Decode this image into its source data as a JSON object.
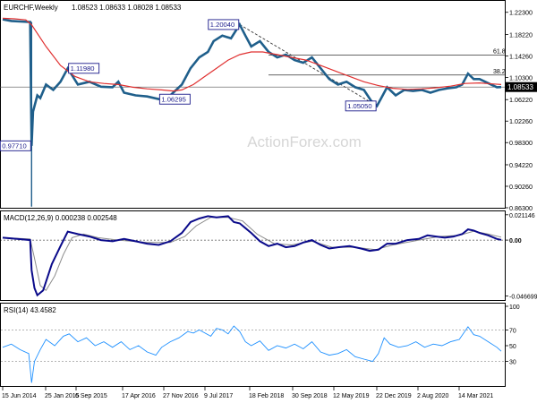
{
  "chart_data": [
    {
      "type": "candlestick",
      "header": {
        "symbol": "EURCHF,Weekly",
        "ohlc": "1.08523 1.08633 1.08028 1.08533"
      },
      "watermark": "ActionForex.com",
      "ylim": [
        0.863,
        1.244
      ],
      "y_ticks": [
        "1.22300",
        "1.18220",
        "1.14260",
        "1.10300",
        "1.06220",
        "1.02260",
        "0.98300",
        "0.94220",
        "0.90260",
        "0.86300"
      ],
      "x_ticks": [
        "15 Jun 2014",
        "25 Jan 2015",
        "6 Sep 2015",
        "17 Apr 2016",
        "27 Nov 2016",
        "9 Jul 2017",
        "18 Feb 2018",
        "30 Sep 2018",
        "12 May 2019",
        "22 Dec 2019",
        "2 Aug 2020",
        "14 Mar 2021"
      ],
      "current_price": "1.08533",
      "ma_color": "#e03030",
      "price_color": "#1f5f8b",
      "price_path": [
        [
          0,
          1.21
        ],
        [
          6,
          1.207
        ],
        [
          12,
          1.206
        ],
        [
          19,
          1.205
        ],
        [
          20,
          0.9771
        ],
        [
          21,
          1.04
        ],
        [
          24,
          1.07
        ],
        [
          26,
          1.065
        ],
        [
          30,
          1.09
        ],
        [
          35,
          1.08
        ],
        [
          40,
          1.095
        ],
        [
          45,
          1.1198
        ],
        [
          52,
          1.09
        ],
        [
          60,
          1.095
        ],
        [
          68,
          1.086
        ],
        [
          76,
          1.085
        ],
        [
          80,
          1.095
        ],
        [
          84,
          1.075
        ],
        [
          92,
          1.07
        ],
        [
          100,
          1.068
        ],
        [
          108,
          1.063
        ],
        [
          116,
          1.07
        ],
        [
          124,
          1.09
        ],
        [
          130,
          1.12
        ],
        [
          136,
          1.14
        ],
        [
          142,
          1.15
        ],
        [
          146,
          1.17
        ],
        [
          152,
          1.18
        ],
        [
          158,
          1.175
        ],
        [
          164,
          1.2004
        ],
        [
          168,
          1.18
        ],
        [
          172,
          1.16
        ],
        [
          178,
          1.17
        ],
        [
          184,
          1.15
        ],
        [
          190,
          1.14
        ],
        [
          196,
          1.145
        ],
        [
          202,
          1.135
        ],
        [
          208,
          1.13
        ],
        [
          214,
          1.14
        ],
        [
          220,
          1.12
        ],
        [
          226,
          1.1
        ],
        [
          232,
          1.09
        ],
        [
          238,
          1.095
        ],
        [
          244,
          1.085
        ],
        [
          250,
          1.08
        ],
        [
          255,
          1.06
        ],
        [
          259,
          1.0505
        ],
        [
          262,
          1.065
        ],
        [
          266,
          1.085
        ],
        [
          272,
          1.07
        ],
        [
          278,
          1.08
        ],
        [
          284,
          1.078
        ],
        [
          290,
          1.08
        ],
        [
          296,
          1.075
        ],
        [
          302,
          1.08
        ],
        [
          308,
          1.083
        ],
        [
          314,
          1.085
        ],
        [
          318,
          1.09
        ],
        [
          322,
          1.11
        ],
        [
          326,
          1.1
        ],
        [
          330,
          1.1
        ],
        [
          334,
          1.095
        ],
        [
          338,
          1.09
        ],
        [
          342,
          1.085
        ],
        [
          345,
          1.0853
        ]
      ],
      "ma_path": [
        [
          0,
          1.212
        ],
        [
          8,
          1.211
        ],
        [
          16,
          1.209
        ],
        [
          20,
          1.2
        ],
        [
          30,
          1.16
        ],
        [
          40,
          1.125
        ],
        [
          50,
          1.105
        ],
        [
          60,
          1.095
        ],
        [
          70,
          1.092
        ],
        [
          80,
          1.09
        ],
        [
          90,
          1.085
        ],
        [
          100,
          1.082
        ],
        [
          110,
          1.08
        ],
        [
          118,
          1.078
        ],
        [
          124,
          1.08
        ],
        [
          132,
          1.09
        ],
        [
          140,
          1.105
        ],
        [
          148,
          1.12
        ],
        [
          156,
          1.135
        ],
        [
          164,
          1.145
        ],
        [
          172,
          1.15
        ],
        [
          180,
          1.15
        ],
        [
          190,
          1.145
        ],
        [
          200,
          1.14
        ],
        [
          210,
          1.135
        ],
        [
          220,
          1.125
        ],
        [
          230,
          1.115
        ],
        [
          240,
          1.105
        ],
        [
          250,
          1.095
        ],
        [
          260,
          1.088
        ],
        [
          270,
          1.083
        ],
        [
          280,
          1.081
        ],
        [
          290,
          1.082
        ],
        [
          300,
          1.084
        ],
        [
          310,
          1.087
        ],
        [
          320,
          1.092
        ],
        [
          330,
          1.093
        ],
        [
          340,
          1.091
        ],
        [
          345,
          1.09
        ]
      ],
      "annotations": [
        {
          "label": "1.20040",
          "t": 164,
          "price": 1.2004,
          "side": "left"
        },
        {
          "label": "1.11980",
          "t": 45,
          "price": 1.1198,
          "side": "right"
        },
        {
          "label": "1.06295",
          "t": 108,
          "price": 1.063,
          "side": "right"
        },
        {
          "label": "0.97710",
          "t": 20,
          "price": 0.9771,
          "side": "left"
        },
        {
          "label": "1.05050",
          "t": 259,
          "price": 1.0505,
          "side": "left"
        }
      ],
      "trendline": [
        [
          164,
          1.2004
        ],
        [
          259,
          1.0505
        ]
      ],
      "fib": [
        {
          "label": "61.8",
          "price": 1.144
        },
        {
          "label": "38.2",
          "price": 1.1075
        }
      ]
    },
    {
      "type": "line",
      "title": "MACD(12,26,9) 0.000238 0.002548",
      "ylim": [
        -0.05,
        0.024
      ],
      "y_ticks": [
        "0.021146",
        "0.00",
        "-0.046699"
      ],
      "macd_color": "#0a0a8a",
      "signal_color": "#8a8a8a",
      "macd_path": [
        [
          0,
          0.002
        ],
        [
          10,
          0.001
        ],
        [
          19,
          0.0
        ],
        [
          20,
          -0.025
        ],
        [
          22,
          -0.04
        ],
        [
          24,
          -0.046
        ],
        [
          28,
          -0.042
        ],
        [
          34,
          -0.02
        ],
        [
          40,
          -0.005
        ],
        [
          45,
          0.007
        ],
        [
          52,
          0.005
        ],
        [
          60,
          0.003
        ],
        [
          68,
          0.0
        ],
        [
          76,
          -0.001
        ],
        [
          84,
          0.001
        ],
        [
          92,
          -0.001
        ],
        [
          100,
          -0.003
        ],
        [
          108,
          -0.004
        ],
        [
          116,
          -0.001
        ],
        [
          124,
          0.006
        ],
        [
          130,
          0.015
        ],
        [
          136,
          0.018
        ],
        [
          142,
          0.02
        ],
        [
          148,
          0.019
        ],
        [
          156,
          0.02
        ],
        [
          160,
          0.015
        ],
        [
          164,
          0.014
        ],
        [
          168,
          0.01
        ],
        [
          172,
          0.006
        ],
        [
          178,
          -0.001
        ],
        [
          184,
          -0.005
        ],
        [
          190,
          -0.003
        ],
        [
          196,
          -0.006
        ],
        [
          202,
          -0.005
        ],
        [
          208,
          -0.002
        ],
        [
          214,
          0.0
        ],
        [
          220,
          -0.004
        ],
        [
          226,
          -0.007
        ],
        [
          232,
          -0.006
        ],
        [
          240,
          -0.005
        ],
        [
          248,
          -0.007
        ],
        [
          254,
          -0.009
        ],
        [
          260,
          -0.008
        ],
        [
          266,
          -0.003
        ],
        [
          272,
          -0.003
        ],
        [
          280,
          0.0
        ],
        [
          288,
          0.001
        ],
        [
          294,
          0.004
        ],
        [
          300,
          0.003
        ],
        [
          306,
          0.002
        ],
        [
          312,
          0.003
        ],
        [
          318,
          0.005
        ],
        [
          322,
          0.009
        ],
        [
          326,
          0.008
        ],
        [
          330,
          0.006
        ],
        [
          336,
          0.004
        ],
        [
          342,
          0.001
        ],
        [
          345,
          0.0002
        ]
      ],
      "signal_path": [
        [
          0,
          0.002
        ],
        [
          19,
          0.001
        ],
        [
          22,
          -0.015
        ],
        [
          26,
          -0.038
        ],
        [
          30,
          -0.042
        ],
        [
          36,
          -0.03
        ],
        [
          42,
          -0.012
        ],
        [
          48,
          0.002
        ],
        [
          56,
          0.005
        ],
        [
          66,
          0.002
        ],
        [
          80,
          0.0
        ],
        [
          100,
          -0.002
        ],
        [
          116,
          -0.002
        ],
        [
          126,
          0.003
        ],
        [
          134,
          0.012
        ],
        [
          144,
          0.019
        ],
        [
          156,
          0.019
        ],
        [
          166,
          0.016
        ],
        [
          176,
          0.005
        ],
        [
          188,
          -0.003
        ],
        [
          200,
          -0.004
        ],
        [
          214,
          -0.001
        ],
        [
          228,
          -0.006
        ],
        [
          244,
          -0.006
        ],
        [
          258,
          -0.008
        ],
        [
          270,
          -0.004
        ],
        [
          288,
          0.0
        ],
        [
          302,
          0.003
        ],
        [
          316,
          0.004
        ],
        [
          326,
          0.0075
        ],
        [
          336,
          0.005
        ],
        [
          345,
          0.0025
        ]
      ]
    },
    {
      "type": "line",
      "title": "RSI(14) 43.4582",
      "ylim": [
        0,
        100
      ],
      "y_ticks": [
        "100",
        "70",
        "50",
        "30"
      ],
      "rsi_color": "#1e90ff",
      "rsi_path": [
        [
          0,
          48
        ],
        [
          6,
          52
        ],
        [
          12,
          45
        ],
        [
          18,
          40
        ],
        [
          20,
          3
        ],
        [
          22,
          30
        ],
        [
          26,
          45
        ],
        [
          30,
          58
        ],
        [
          36,
          50
        ],
        [
          42,
          62
        ],
        [
          46,
          65
        ],
        [
          52,
          55
        ],
        [
          58,
          60
        ],
        [
          64,
          50
        ],
        [
          70,
          55
        ],
        [
          76,
          48
        ],
        [
          82,
          55
        ],
        [
          88,
          45
        ],
        [
          94,
          50
        ],
        [
          100,
          42
        ],
        [
          106,
          38
        ],
        [
          110,
          48
        ],
        [
          116,
          55
        ],
        [
          122,
          60
        ],
        [
          128,
          68
        ],
        [
          132,
          66
        ],
        [
          136,
          70
        ],
        [
          140,
          66
        ],
        [
          144,
          62
        ],
        [
          148,
          72
        ],
        [
          152,
          70
        ],
        [
          156,
          65
        ],
        [
          160,
          75
        ],
        [
          164,
          68
        ],
        [
          168,
          55
        ],
        [
          172,
          50
        ],
        [
          178,
          56
        ],
        [
          184,
          44
        ],
        [
          190,
          50
        ],
        [
          196,
          47
        ],
        [
          202,
          52
        ],
        [
          208,
          46
        ],
        [
          214,
          55
        ],
        [
          220,
          42
        ],
        [
          226,
          38
        ],
        [
          232,
          40
        ],
        [
          238,
          45
        ],
        [
          244,
          36
        ],
        [
          250,
          33
        ],
        [
          256,
          30
        ],
        [
          260,
          40
        ],
        [
          264,
          60
        ],
        [
          268,
          52
        ],
        [
          274,
          48
        ],
        [
          280,
          50
        ],
        [
          286,
          55
        ],
        [
          292,
          48
        ],
        [
          298,
          52
        ],
        [
          304,
          50
        ],
        [
          310,
          55
        ],
        [
          316,
          58
        ],
        [
          322,
          74
        ],
        [
          326,
          64
        ],
        [
          330,
          62
        ],
        [
          336,
          55
        ],
        [
          342,
          48
        ],
        [
          345,
          43
        ]
      ]
    }
  ]
}
